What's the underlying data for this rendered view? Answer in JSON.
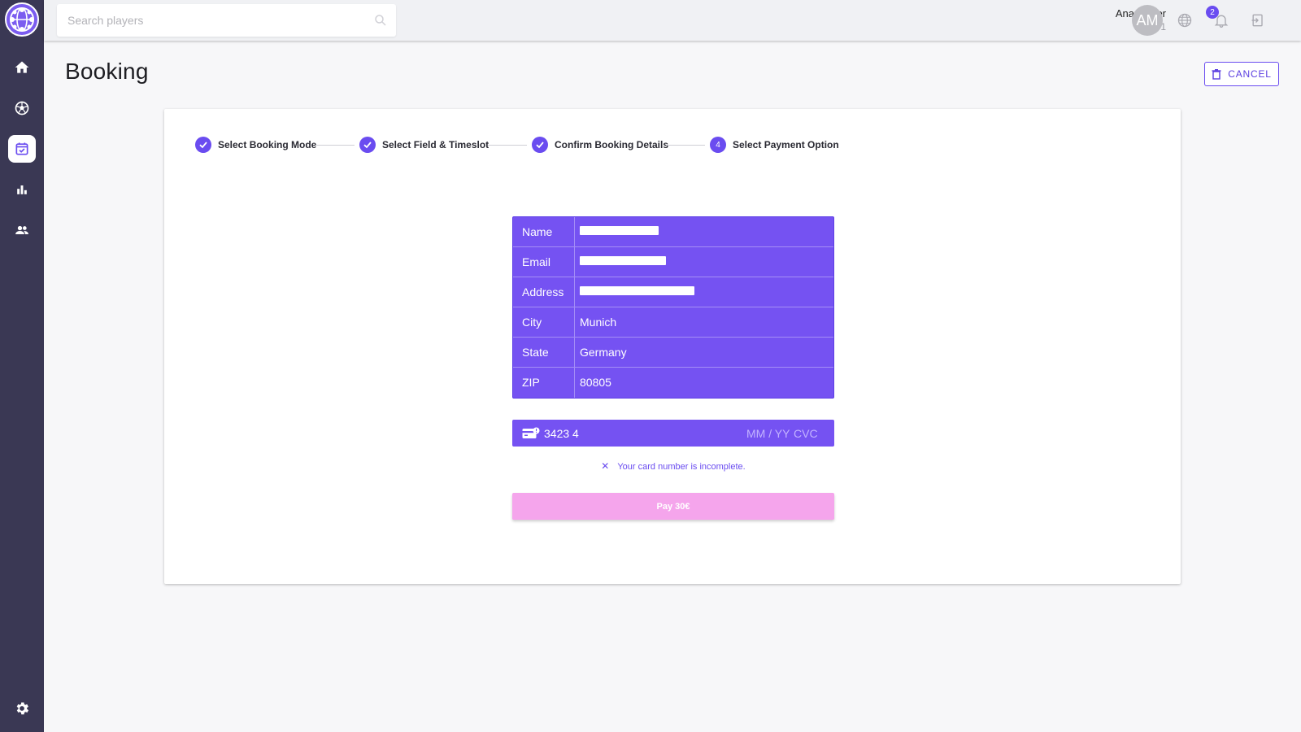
{
  "topbar": {
    "search_placeholder": "Search players",
    "user_name": "Ana Muller",
    "user_level": "Level 1",
    "avatar_initials": "AM",
    "notification_count": "2"
  },
  "sidebar": {
    "items": [
      {
        "name": "home",
        "icon": "home-icon"
      },
      {
        "name": "fields",
        "icon": "soccer-ball-icon"
      },
      {
        "name": "bookings",
        "icon": "calendar-check-icon",
        "active": true
      },
      {
        "name": "stats",
        "icon": "bar-chart-icon"
      },
      {
        "name": "players",
        "icon": "group-icon"
      }
    ],
    "bottom_item": {
      "name": "settings",
      "icon": "gear-icon"
    }
  },
  "page": {
    "title": "Booking",
    "cancel_label": "CANCEL"
  },
  "stepper": {
    "steps": [
      {
        "label": "Select Booking Mode",
        "state": "completed"
      },
      {
        "label": "Select Field & Timeslot",
        "state": "completed"
      },
      {
        "label": "Confirm Booking Details",
        "state": "completed"
      },
      {
        "label": "Select Payment Option",
        "state": "active",
        "number": "4"
      }
    ]
  },
  "details": {
    "rows": [
      {
        "label": "Name",
        "value": "",
        "redacted": true
      },
      {
        "label": "Email",
        "value": "",
        "redacted": true
      },
      {
        "label": "Address",
        "value": "",
        "redacted": true
      },
      {
        "label": "City",
        "value": "Munich"
      },
      {
        "label": "State",
        "value": "Germany"
      },
      {
        "label": "ZIP",
        "value": "80805"
      }
    ]
  },
  "payment": {
    "card_number": "3423 4",
    "expiry_placeholder": "MM / YY",
    "cvc_placeholder": "CVC",
    "error_message": "Your card number is incomplete.",
    "pay_label": "Pay 30€"
  },
  "colors": {
    "accent": "#6a4cf0",
    "panel": "#7552f2",
    "sidebar": "#3a3854",
    "pay_button": "#f5a5ec"
  }
}
